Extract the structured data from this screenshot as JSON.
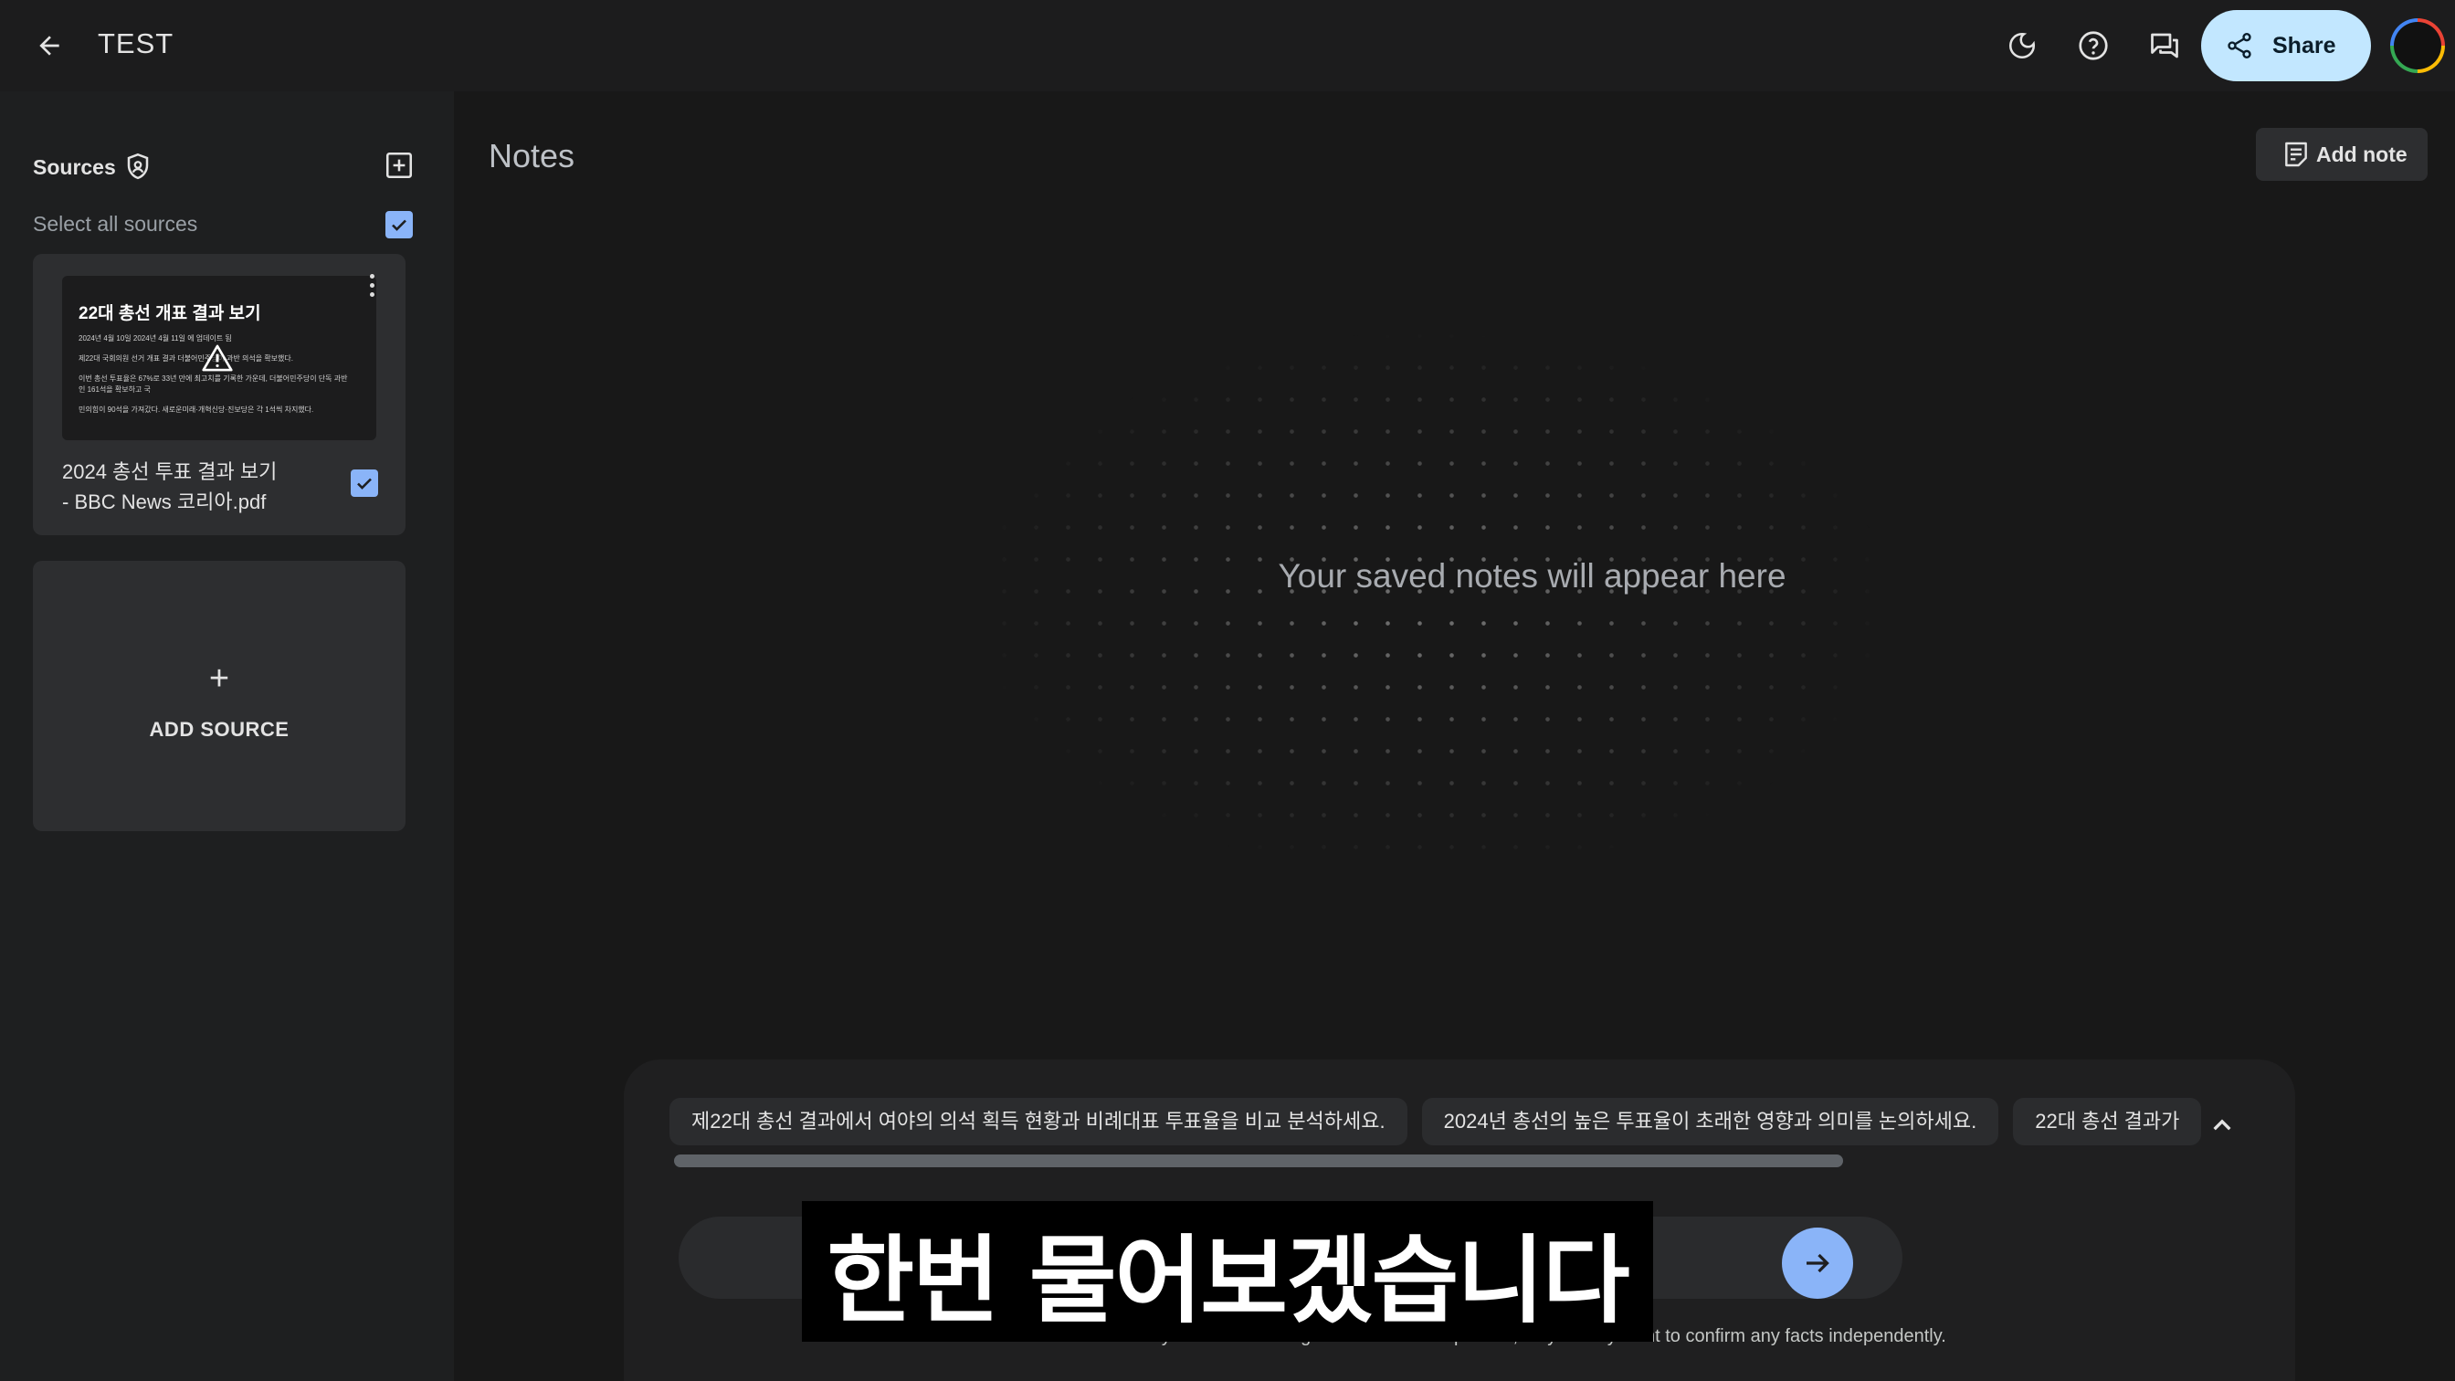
{
  "topbar": {
    "title": "TEST",
    "share_label": "Share",
    "icons": [
      "arrow-back-icon",
      "dark-mode-icon",
      "help-icon",
      "chat-feedback-icon",
      "share-icon"
    ]
  },
  "sidebar": {
    "sources_label": "Sources",
    "select_all_label": "Select all sources",
    "select_all_checked": true,
    "source": {
      "thumb_title": "22대 총선 개표 결과 보기",
      "thumb_lines": [
        "2024년 4월 10일 2024년 4월 11일 에 업데이트 됨",
        "제22대 국회의원 선거 개표 결과 더불어민주당이 과반 의석을 확보했다.",
        "이번 총선 투표율은 67%로 33년 만에 최고치를 기록한 가운데, 더불어민주당이 단독 과반",
        "인 161석을 확보하고 국",
        "민의힘이 90석을 가져갔다. 새로운미래·개혁신당·진보당은 각 1석씩 차지했다."
      ],
      "name_line1": "2024 총선 투표 결과 보기",
      "name_line2": "- BBC News 코리아.pdf",
      "checked": true
    },
    "add_source_plus": "+",
    "add_source_label": "ADD SOURCE"
  },
  "notes": {
    "title": "Notes",
    "add_note_label": "Add note",
    "empty_text": "Your saved notes will appear here"
  },
  "chat": {
    "suggestions": [
      "제22대 총선 결과에서 여야의 의석 획득 현황과 비례대표 투표율을 비교 분석하세요.",
      "2024년 총선의 높은 투표율이 초래한 영향과 의미를 논의하세요.",
      "22대 총선 결과가"
    ],
    "disclaimer": "NotebookLM may still sometimes give inaccurate responses, so you may want to confirm any facts independently."
  },
  "caption": {
    "text": "한번 물어보겠습니다"
  },
  "colors": {
    "accent": "#8ab4f8",
    "share_bg": "#c2e7ff",
    "background": "#181818"
  }
}
